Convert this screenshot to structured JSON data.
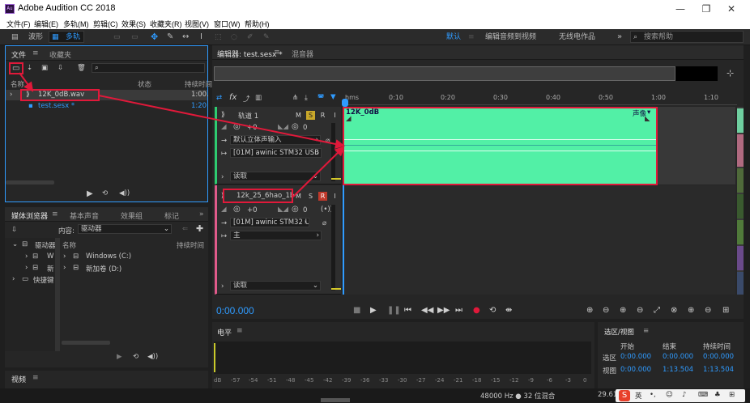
{
  "window": {
    "title": "Adobe Audition CC 2018",
    "app_icon": "Au",
    "min": "—",
    "max": "❐",
    "close": "✕"
  },
  "menu": [
    "文件(F)",
    "编辑(E)",
    "多轨(M)",
    "剪辑(C)",
    "效果(S)",
    "收藏夹(R)",
    "视图(V)",
    "窗口(W)",
    "帮助(H)"
  ],
  "toolbar": {
    "waveform": "波形",
    "multitrack": "多轨",
    "workspace_default": "默认",
    "workspace_edit_video": "编辑音频到视频",
    "workspace_radio": "无线电作品",
    "more": "»",
    "search_placeholder": "搜索帮助"
  },
  "files_panel": {
    "tab_files": "文件",
    "tab_favorites": "收藏夹",
    "col_name": "名称",
    "col_status": "状态",
    "col_duration": "持续时间",
    "items": [
      {
        "name": "12K_0dB.wav",
        "duration": "1:00."
      },
      {
        "name": "test.sesx *",
        "duration": "1:20."
      }
    ]
  },
  "media_panel": {
    "tabs": [
      "媒体浏览器",
      "基本声音",
      "效果组",
      "标记"
    ],
    "content_label": "内容:",
    "content_value": "驱动器",
    "col_name": "名称",
    "col_duration": "持续时间",
    "tree_left": [
      "驱动器",
      "W",
      "新",
      "快捷键"
    ],
    "drives": [
      "Windows (C:)",
      "新加卷 (D:)"
    ]
  },
  "video_panel": {
    "tab": "视频"
  },
  "editor": {
    "tab": "编辑器: test.sesx *",
    "tab_mixer": "混音器",
    "ruler": [
      "hms",
      "0:10",
      "0:20",
      "0:30",
      "0:40",
      "0:50",
      "1:00",
      "1:10"
    ],
    "tracks": [
      {
        "name": "轨道 1",
        "m": "M",
        "s": "S",
        "r": "R",
        "i": "I",
        "volume": "+0",
        "pan": "0",
        "input": "默认立体声输入",
        "output": "[01M] awinic STM32 USB AL",
        "read": "读取",
        "clip_name": "12K_0dB",
        "clip_tag": "声像"
      },
      {
        "name": "12k_25_6hao_1b",
        "m": "M",
        "s": "S",
        "r": "R",
        "i": "I",
        "volume": "+0",
        "pan": "0",
        "output": "[01M] awinic STM32 US",
        "bus": "主",
        "read": "读取"
      }
    ],
    "time": "0:00.000"
  },
  "levels": {
    "tab": "电平",
    "scale": [
      "dB",
      "-57",
      "-54",
      "-51",
      "-48",
      "-45",
      "-42",
      "-39",
      "-36",
      "-33",
      "-30",
      "-27",
      "-24",
      "-21",
      "-18",
      "-15",
      "-12",
      "-9",
      "-6",
      "-3",
      "0"
    ]
  },
  "selection": {
    "tab": "选区/视图",
    "col_start": "开始",
    "col_end": "结束",
    "col_duration": "持续时间",
    "row_selection": "选区",
    "row_view": "视图",
    "sel_start": "0:00.000",
    "sel_end": "0:00.000",
    "sel_duration": "0:00.000",
    "view_start": "0:00.000",
    "view_end": "1:13.504",
    "view_duration": "1:13.504"
  },
  "status": {
    "format": "48000 Hz ● 32 位混合",
    "size": "29.61",
    "ime": "英"
  },
  "colors": {
    "accent": "#2f9bff",
    "clip": "#52f0a6",
    "highlight": "#e0193a",
    "solo": "#c9a82a",
    "record": "#c0392b"
  }
}
